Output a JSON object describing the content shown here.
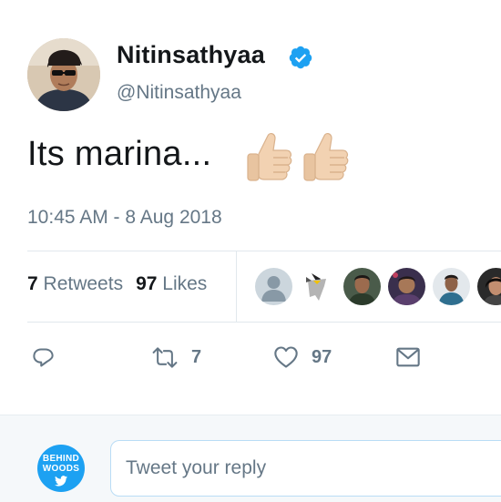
{
  "tweet": {
    "display_name": "Nitinsathyaa",
    "handle": "@Nitinsathyaa",
    "text": "Its marina...",
    "emoji": [
      "thumbs-up-light-skin-icon",
      "thumbs-up-light-skin-icon"
    ],
    "timestamp": "10:45 AM - 8 Aug 2018",
    "verified": true
  },
  "stats": {
    "retweets_count": "7",
    "retweets_label": "Retweets",
    "likes_count": "97",
    "likes_label": "Likes"
  },
  "likers": [
    "default-avatar",
    "bird-avatar",
    "user-avatar",
    "user-avatar",
    "user-avatar",
    "user-avatar"
  ],
  "actions": {
    "reply_icon": "reply-icon",
    "retweet_icon": "retweet-icon",
    "retweet_count": "7",
    "like_icon": "heart-icon",
    "like_count": "97",
    "dm_icon": "envelope-icon"
  },
  "reply_box": {
    "placeholder": "Tweet your reply",
    "logo_line1": "BEHIND",
    "logo_line2": "WOODS"
  },
  "colors": {
    "accent": "#1da1f2",
    "text": "#14171a",
    "muted": "#657786",
    "border": "#e1e8ed"
  }
}
